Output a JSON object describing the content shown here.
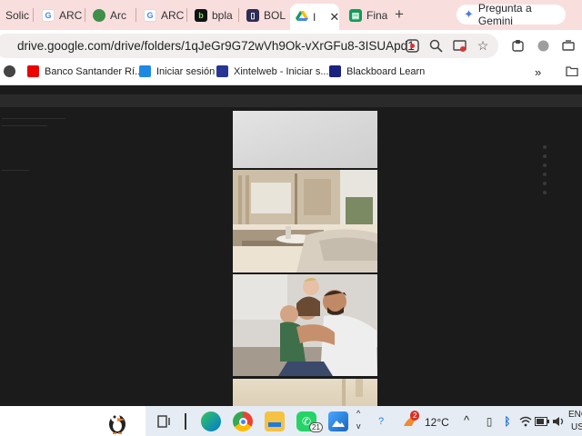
{
  "tabs": [
    {
      "label": "Solic",
      "icon": "page-icon",
      "color": "#9aa0a6"
    },
    {
      "label": "ARC",
      "icon": "google-icon",
      "color": "#4285f4"
    },
    {
      "label": "Arc",
      "icon": "globe-icon",
      "color": "#2e7d32"
    },
    {
      "label": "ARC",
      "icon": "google-icon",
      "color": "#4285f4"
    },
    {
      "label": "bpla",
      "icon": "b-icon",
      "color": "#111111"
    },
    {
      "label": "BOL",
      "icon": "doc-icon",
      "color": "#2c2c54"
    },
    {
      "label": "I",
      "icon": "google-drive-icon",
      "color": "#ffffff",
      "active": true
    },
    {
      "label": "Fina",
      "icon": "sheets-icon",
      "color": "#0f9d58"
    }
  ],
  "new_tab_label": "+",
  "gemini_label": "Pregunta a Gemini",
  "address": {
    "url": "drive.google.com/drive/folders/1qJeGr9G72wVh9Ok-vXrGFu8-3ISUApd1"
  },
  "bookmarks": [
    {
      "label": "Banco Santander Rí...",
      "icon": "santander-icon",
      "color": "#ec0000"
    },
    {
      "label": "Iniciar sesión",
      "icon": "login-icon",
      "color": "#1e88e5"
    },
    {
      "label": "Xintelweb - Iniciar s...",
      "icon": "xintelweb-icon",
      "color": "#283593"
    },
    {
      "label": "Blackboard Learn",
      "icon": "blackboard-icon",
      "color": "#1a237e"
    }
  ],
  "bookmarks_more": "»",
  "taskbar": {
    "whatsapp_badge": "21",
    "notification_badge": "2",
    "temperature": "12°C",
    "language": "ENG",
    "region": "US"
  }
}
